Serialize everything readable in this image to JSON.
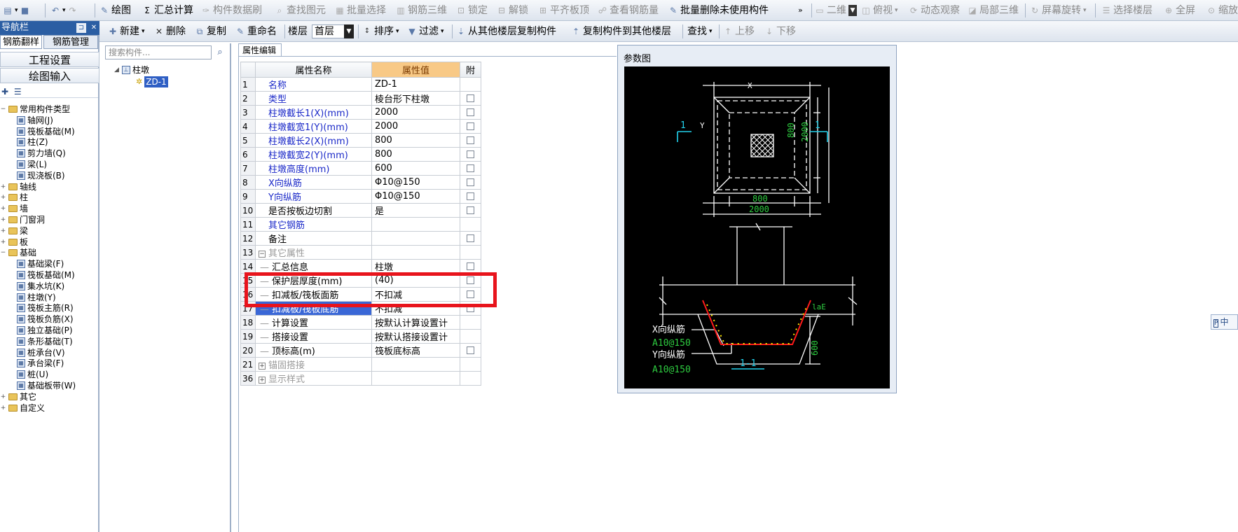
{
  "toolbar_main": {
    "items": [
      {
        "label": "绘图",
        "icon": "draw-icon"
      },
      {
        "label": "汇总计算",
        "icon": "sigma-icon"
      },
      {
        "label": "构件数据刷",
        "icon": "brush-icon"
      },
      {
        "label": "查找图元",
        "icon": "find-icon"
      },
      {
        "label": "批量选择",
        "icon": "batch-select-icon"
      },
      {
        "label": "钢筋三维",
        "icon": "rebar-3d-icon"
      },
      {
        "label": "锁定",
        "icon": "lock-icon"
      },
      {
        "label": "解锁",
        "icon": "unlock-icon"
      },
      {
        "label": "平齐板顶",
        "icon": "align-slab-icon"
      },
      {
        "label": "查看钢筋量",
        "icon": "view-rebar-icon"
      },
      {
        "label": "批量删除未使用构件",
        "icon": "batch-delete-icon"
      }
    ],
    "view_select": "二维",
    "right_items": [
      {
        "label": "俯视",
        "icon": "top-view-icon"
      },
      {
        "label": "动态观察",
        "icon": "orbit-icon"
      },
      {
        "label": "局部三维",
        "icon": "local-3d-icon"
      },
      {
        "label": "屏幕旋转",
        "icon": "rotate-icon"
      },
      {
        "label": "选择楼层",
        "icon": "floor-select-icon"
      },
      {
        "label": "全屏",
        "icon": "fullscreen-icon"
      },
      {
        "label": "缩放",
        "icon": "zoom-icon"
      }
    ]
  },
  "toolbar_component": {
    "new": "新建",
    "delete": "删除",
    "copy": "复制",
    "rename": "重命名",
    "floor_label": "楼层",
    "floor_value": "首层",
    "sort": "排序",
    "filter": "过滤",
    "copy_from_floor": "从其他楼层复制构件",
    "copy_to_floor": "复制构件到其他楼层",
    "find": "查找",
    "move_up": "上移",
    "move_down": "下移"
  },
  "nav": {
    "title": "导航栏",
    "tab_rebar_flip": "钢筋翻样",
    "tab_rebar_manage": "钢筋管理",
    "project_settings": "工程设置",
    "drawing_input": "绘图输入",
    "common_group": "常用构件类型",
    "common_items": [
      {
        "label": "轴网(J)",
        "icon": "grid-icon"
      },
      {
        "label": "筏板基础(M)",
        "icon": "raft-foundation-icon"
      },
      {
        "label": "柱(Z)",
        "icon": "column-icon"
      },
      {
        "label": "剪力墙(Q)",
        "icon": "shear-wall-icon"
      },
      {
        "label": "梁(L)",
        "icon": "beam-icon"
      },
      {
        "label": "现浇板(B)",
        "icon": "slab-icon"
      }
    ],
    "folders": [
      "轴线",
      "柱",
      "墙",
      "门窗洞",
      "梁",
      "板"
    ],
    "foundation_group": "基础",
    "foundation_items": [
      {
        "label": "基础梁(F)",
        "icon": "foundation-beam-icon"
      },
      {
        "label": "筏板基础(M)",
        "icon": "raft-foundation-icon"
      },
      {
        "label": "集水坑(K)",
        "icon": "sump-icon"
      },
      {
        "label": "柱墩(Y)",
        "icon": "column-pier-icon"
      },
      {
        "label": "筏板主筋(R)",
        "icon": "raft-main-rebar-icon"
      },
      {
        "label": "筏板负筋(X)",
        "icon": "raft-neg-rebar-icon"
      },
      {
        "label": "独立基础(P)",
        "icon": "isolated-foundation-icon"
      },
      {
        "label": "条形基础(T)",
        "icon": "strip-foundation-icon"
      },
      {
        "label": "桩承台(V)",
        "icon": "pile-cap-icon"
      },
      {
        "label": "承台梁(F)",
        "icon": "cap-beam-icon"
      },
      {
        "label": "桩(U)",
        "icon": "pile-icon"
      },
      {
        "label": "基础板带(W)",
        "icon": "foundation-strip-icon"
      }
    ],
    "other": "其它",
    "custom": "自定义"
  },
  "component_tree": {
    "search_placeholder": "搜索构件...",
    "root": "柱墩",
    "child": "ZD-1"
  },
  "property_editor": {
    "tab": "属性编辑",
    "col_name": "属性名称",
    "col_value": "属性值",
    "col_attach": "附",
    "rows": [
      {
        "n": "1",
        "name": "名称",
        "value": "ZD-1",
        "blue": true,
        "check": false
      },
      {
        "n": "2",
        "name": "类型",
        "value": "棱台形下柱墩",
        "blue": true,
        "check": true
      },
      {
        "n": "3",
        "name": "柱墩截长1(X)(mm)",
        "value": "2000",
        "blue": true,
        "check": true
      },
      {
        "n": "4",
        "name": "柱墩截宽1(Y)(mm)",
        "value": "2000",
        "blue": true,
        "check": true
      },
      {
        "n": "5",
        "name": "柱墩截长2(X)(mm)",
        "value": "800",
        "blue": true,
        "check": true
      },
      {
        "n": "6",
        "name": "柱墩截宽2(Y)(mm)",
        "value": "800",
        "blue": true,
        "check": true
      },
      {
        "n": "7",
        "name": "柱墩高度(mm)",
        "value": "600",
        "blue": true,
        "check": true
      },
      {
        "n": "8",
        "name": "X向纵筋",
        "value": "Φ10@150",
        "blue": true,
        "check": true
      },
      {
        "n": "9",
        "name": "Y向纵筋",
        "value": "Φ10@150",
        "blue": true,
        "check": true
      },
      {
        "n": "10",
        "name": "是否按板边切割",
        "value": "是",
        "blue": false,
        "check": true
      },
      {
        "n": "11",
        "name": "其它钢筋",
        "value": "",
        "blue": true,
        "check": false
      },
      {
        "n": "12",
        "name": "备注",
        "value": "",
        "blue": false,
        "check": true
      },
      {
        "n": "13",
        "name": "其它属性",
        "value": "",
        "group": true,
        "toggle": "−",
        "check": false
      },
      {
        "n": "14",
        "name": "汇总信息",
        "value": "柱墩",
        "indent": true,
        "check": true
      },
      {
        "n": "15",
        "name": "保护层厚度(mm)",
        "value": "(40)",
        "indent": true,
        "check": true
      },
      {
        "n": "16",
        "name": "扣减板/筏板面筋",
        "value": "不扣减",
        "indent": true,
        "check": true
      },
      {
        "n": "17",
        "name": "扣减板/筏板底筋",
        "value": "不扣减",
        "indent": true,
        "check": true,
        "selected": true
      },
      {
        "n": "18",
        "name": "计算设置",
        "value": "按默认计算设置计",
        "indent": true,
        "check": false
      },
      {
        "n": "19",
        "name": "搭接设置",
        "value": "按默认搭接设置计",
        "indent": true,
        "check": false
      },
      {
        "n": "20",
        "name": "顶标高(m)",
        "value": "筏板底标高",
        "indent": true,
        "check": true
      },
      {
        "n": "21",
        "name": "锚固搭接",
        "value": "",
        "group": true,
        "toggle": "+",
        "check": false
      },
      {
        "n": "36",
        "name": "显示样式",
        "value": "",
        "group": true,
        "toggle": "+",
        "check": false
      }
    ]
  },
  "param_diagram": {
    "title": "参数图",
    "labels": {
      "x": "X",
      "y": "Y",
      "sec_left": "1",
      "sec_right": "1",
      "d800_v": "800",
      "d2000_v": "2000",
      "d800_h": "800",
      "d2000_h": "2000",
      "lae": "laE",
      "h600": "600",
      "x_rebar": "X向纵筋",
      "x_rebar_spec": "A10@150",
      "y_rebar": "Y向纵筋",
      "y_rebar_spec": "A10@150",
      "section": "1-1"
    },
    "colors": {
      "green": "#2ecc40",
      "cyan": "#22d3ee",
      "red": "#ff1a1a",
      "yellow": "#ffe600"
    }
  },
  "ime": {
    "label": "中"
  }
}
